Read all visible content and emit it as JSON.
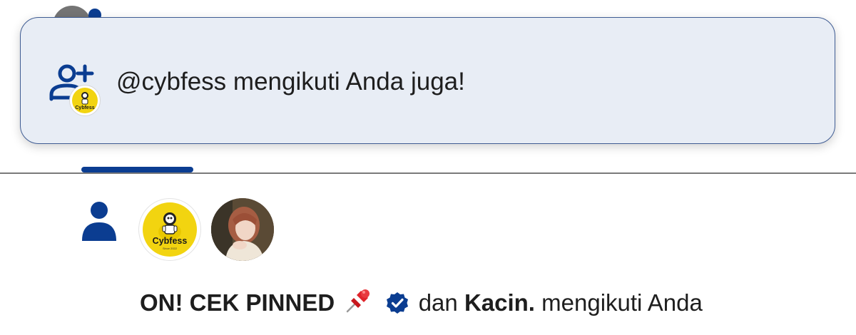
{
  "toast": {
    "message": "@cybfess mengikuti Anda juga!",
    "icon": "add-user-icon"
  },
  "tabs": {
    "active_indicator_color": "#0b3d91"
  },
  "notification": {
    "icon": "person-icon",
    "avatars": [
      {
        "name": "cybfess",
        "logo_text": "Cybfess",
        "logo_subtext": "Since 2022",
        "color": "#f2d410"
      },
      {
        "name": "Kacin.",
        "type": "photo"
      }
    ],
    "actor1": "ON! CEK PINNED",
    "pin_icon": "pushpin-icon",
    "verified_icon": "verified-badge-icon",
    "connector": "dan",
    "actor2": "Kacin.",
    "action": "mengikuti Anda"
  },
  "colors": {
    "accent": "#0b3d91",
    "toast_bg": "#e8edf5",
    "toast_border": "#3f5c93"
  }
}
